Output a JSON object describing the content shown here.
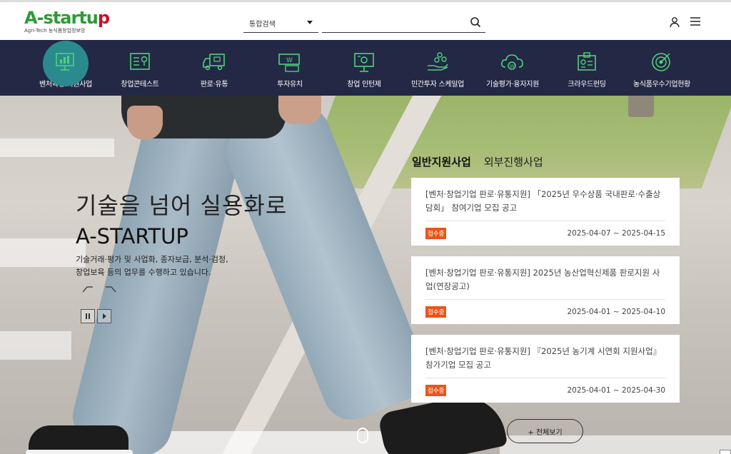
{
  "logo": {
    "main_prefix": "A",
    "main_mid": "-startu",
    "main_suffix": "p",
    "sub": "Agri-Tech 농식품창업정보망"
  },
  "search": {
    "select_value": "통합검색",
    "placeholder": ""
  },
  "nav": {
    "items": [
      {
        "label": "벤처육성 지원사업",
        "icon": "monitor-chart-icon"
      },
      {
        "label": "창업콘테스트",
        "icon": "trophy-board-icon"
      },
      {
        "label": "판로·유통",
        "icon": "delivery-truck-icon"
      },
      {
        "label": "투자유치",
        "icon": "money-bill-icon"
      },
      {
        "label": "창업 인턴제",
        "icon": "presentation-board-icon"
      },
      {
        "label": "민간투자 스케일업",
        "icon": "hand-coins-icon"
      },
      {
        "label": "기술평가·융자지원",
        "icon": "cloud-coin-icon"
      },
      {
        "label": "크라우드펀딩",
        "icon": "id-card-icon"
      },
      {
        "label": "농식품우수기업현황",
        "icon": "target-icon"
      }
    ]
  },
  "hero": {
    "title": "기술을 넘어 실용화로",
    "brand": "A-STARTUP",
    "desc_line1": "기술거래·평가 및 사업화, 종자보급, 분석·검정,",
    "desc_line2": "창업보육 등의 업무를 수행하고 있습니다."
  },
  "notices": {
    "tabs": [
      "일반지원사업",
      "외부진행사업"
    ],
    "items": [
      {
        "title": "[벤처·창업기업 판로·유통지원] 「2025년 우수상품 국내판로·수출상담회」 참여기업 모집 공고",
        "badge": "접수중",
        "date": "2025-04-07 ~ 2025-04-15"
      },
      {
        "title": "[벤처·창업기업 판로·유통지원] 2025년 농산업혁신제품 판로지원 사업(연장공고)",
        "badge": "접수중",
        "date": "2025-04-01 ~ 2025-04-10"
      },
      {
        "title": "[벤처·창업기업 판로·유통지원] 『2025년 농기계 시연회 지원사업』 참가기업 모집 공고",
        "badge": "접수중",
        "date": "2025-04-01 ~ 2025-04-30"
      }
    ],
    "more_label": "+ 전체보기"
  },
  "colors": {
    "nav_bg": "#232845",
    "accent_green": "#2f9a35",
    "active_bubble": "#2b8a8d",
    "badge_orange": "#e8561b",
    "icon_green": "#4fd17a"
  }
}
